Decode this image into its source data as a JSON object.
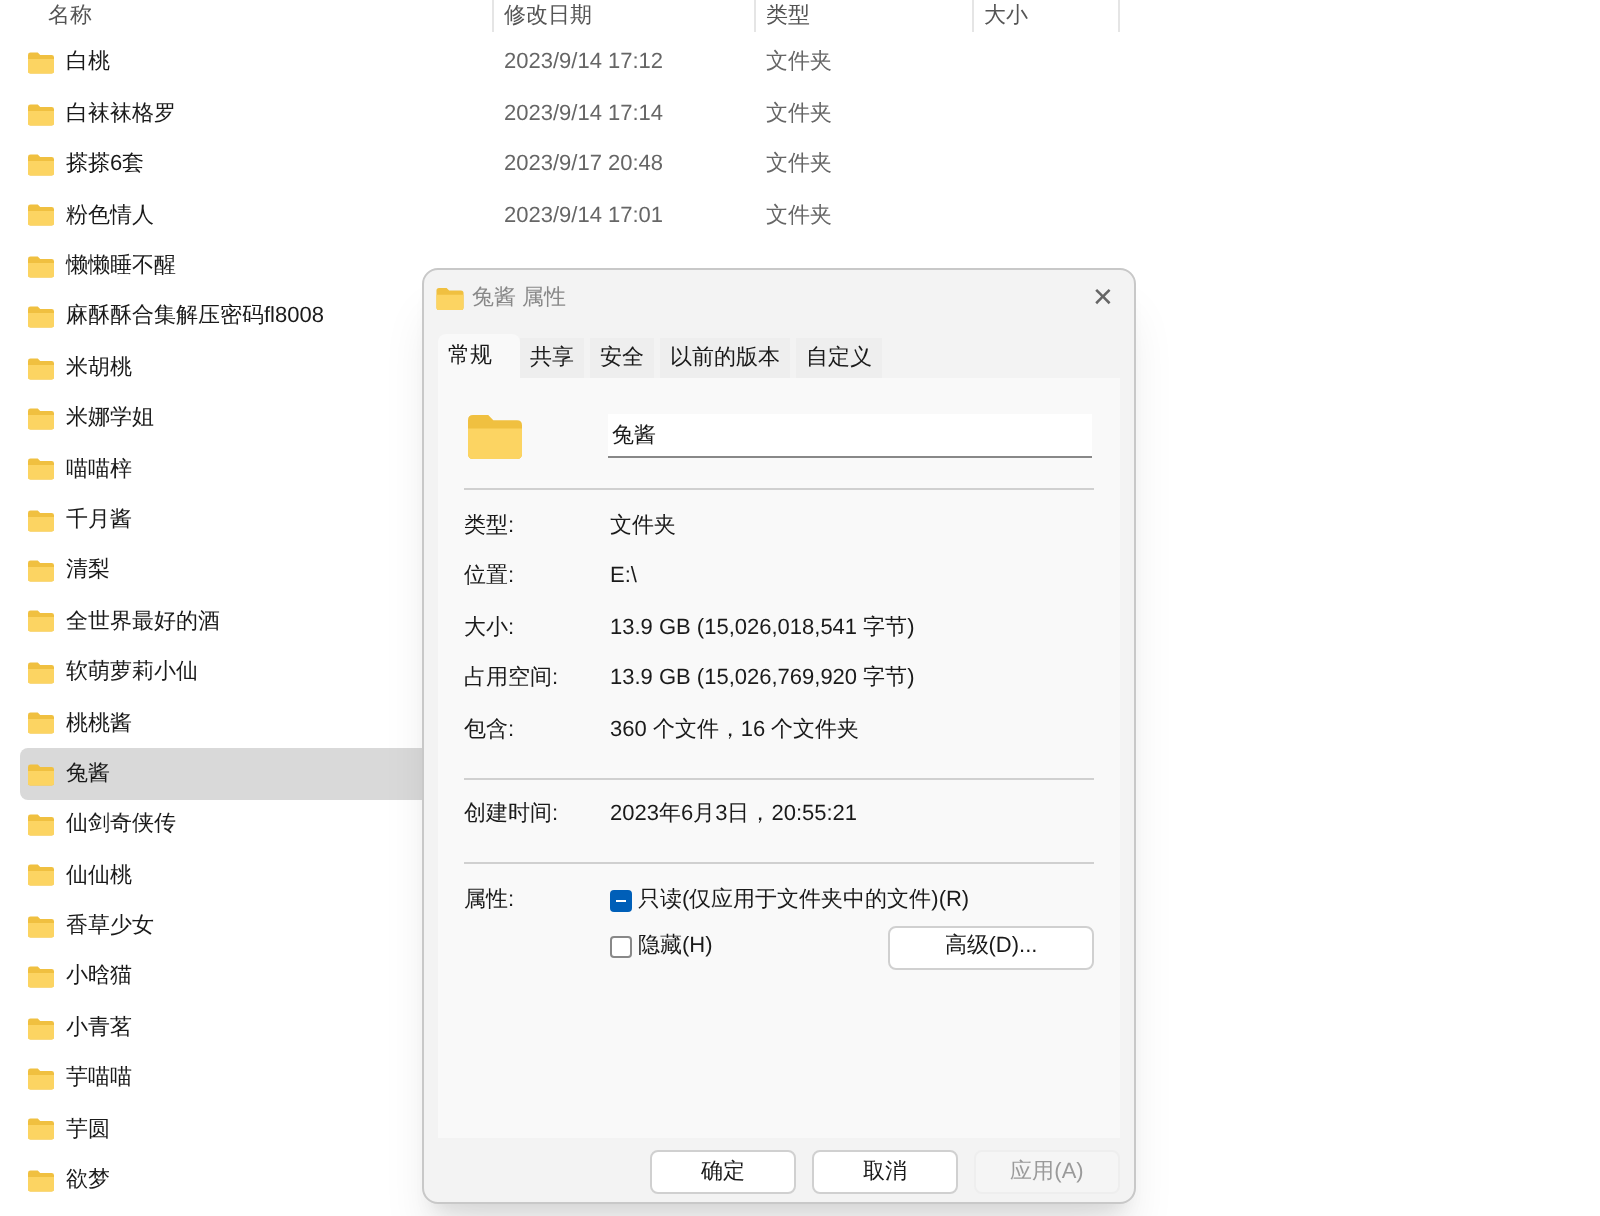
{
  "columns": [
    {
      "label": "名称"
    },
    {
      "label": "修改日期"
    },
    {
      "label": "类型"
    },
    {
      "label": "大小"
    }
  ],
  "rows": [
    {
      "name": "白桃",
      "date": "2023/9/14 17:12",
      "type": "文件夹",
      "selected": false
    },
    {
      "name": "白袜袜格罗",
      "date": "2023/9/14 17:14",
      "type": "文件夹",
      "selected": false
    },
    {
      "name": "搽搽6套",
      "date": "2023/9/17 20:48",
      "type": "文件夹",
      "selected": false
    },
    {
      "name": "粉色情人",
      "date": "2023/9/14 17:01",
      "type": "文件夹",
      "selected": false
    },
    {
      "name": "懒懒睡不醒",
      "selected": false
    },
    {
      "name": "麻酥酥合集解压密码fl8008",
      "selected": false
    },
    {
      "name": "米胡桃",
      "selected": false
    },
    {
      "name": "米娜学姐",
      "selected": false
    },
    {
      "name": "喵喵梓",
      "selected": false
    },
    {
      "name": "千月酱",
      "selected": false
    },
    {
      "name": "清梨",
      "selected": false
    },
    {
      "name": "全世界最好的酒",
      "selected": false
    },
    {
      "name": "软萌萝莉小仙",
      "selected": false
    },
    {
      "name": "桃桃酱",
      "selected": false
    },
    {
      "name": "兔酱",
      "selected": true
    },
    {
      "name": "仙剑奇侠传",
      "selected": false
    },
    {
      "name": "仙仙桃",
      "selected": false
    },
    {
      "name": "香草少女",
      "selected": false
    },
    {
      "name": "小晗猫",
      "selected": false
    },
    {
      "name": "小青茗",
      "selected": false
    },
    {
      "name": "芋喵喵",
      "selected": false
    },
    {
      "name": "芋圆",
      "selected": false
    },
    {
      "name": "欲梦",
      "selected": false
    }
  ],
  "dialog": {
    "title": "兔酱 属性",
    "close": "✕",
    "tabs": [
      {
        "label": "常规",
        "selected": true
      },
      {
        "label": "共享",
        "selected": false
      },
      {
        "label": "安全",
        "selected": false
      },
      {
        "label": "以前的版本",
        "selected": false
      },
      {
        "label": "自定义",
        "selected": false
      }
    ],
    "name_field": {
      "value": "兔酱"
    },
    "property_groups": [
      [
        {
          "label": "类型:",
          "value": "文件夹"
        },
        {
          "label": "位置:",
          "value": "E:\\"
        },
        {
          "label": "大小:",
          "value": "13.9 GB (15,026,018,541 字节)"
        },
        {
          "label": "占用空间:",
          "value": "13.9 GB (15,026,769,920 字节)"
        },
        {
          "label": "包含:",
          "value": "360 个文件，16 个文件夹"
        }
      ],
      [
        {
          "label": "创建时间:",
          "value": "2023年6月3日，20:55:21"
        }
      ]
    ],
    "attributes_label": "属性:",
    "checkboxes": [
      {
        "label": "只读(仅应用于文件夹中的文件)(R)",
        "indeterminate": true
      },
      {
        "label": "隐藏(H)",
        "indeterminate": false
      }
    ],
    "advanced_button": "高级(D)...",
    "buttons": [
      {
        "label": "确定",
        "disabled": false
      },
      {
        "label": "取消",
        "disabled": false
      },
      {
        "label": "应用(A)",
        "disabled": true
      }
    ]
  }
}
